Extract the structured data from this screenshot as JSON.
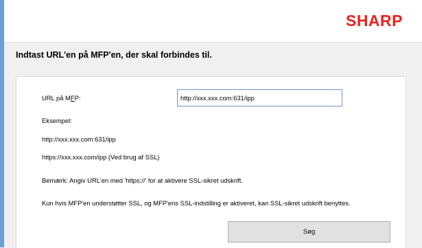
{
  "brand": {
    "logo_text": "SHARP",
    "logo_color": "#e8221c"
  },
  "header": {
    "heading": "Indtast URL'en på MFP'en, der skal forbindes til."
  },
  "form": {
    "url_label_pre": "URL på M",
    "url_label_mnemonic": "F",
    "url_label_post": "P:",
    "url_value": "http://xxx.xxx.com:631/ipp"
  },
  "example": {
    "title": "Eksempel:",
    "line1": "http://xxx.xxx.com:631/ipp",
    "line2": "https://xxx.xxx.com/ipp (Ved brug af SSL)"
  },
  "notes": {
    "note1": "Bemærk: Angiv URL'en med 'https://' for at aktivere SSL-sikret udskrift.",
    "note2": "Kun hvis MFP'en understøtter SSL, og MFP'ens SSL-indstilling er aktiveret, kan SSL-sikret udskrift benyttes."
  },
  "buttons": {
    "search_pre": "Sø",
    "search_mnemonic": "g"
  },
  "colors": {
    "accent_strip": "#6d9fd6",
    "input_border": "#6b97d0",
    "button_bg": "#e1e1e1"
  }
}
